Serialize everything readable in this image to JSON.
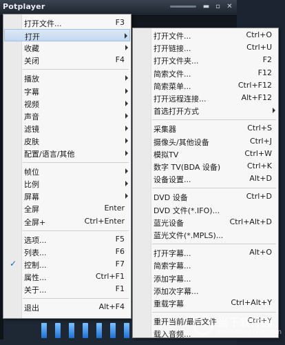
{
  "app": {
    "title": "Potplayer",
    "controls": [
      "▬",
      "▫",
      "✕"
    ]
  },
  "main_menu": [
    {
      "label": "打开文件...",
      "shortcut": "F3"
    },
    {
      "label": "打开",
      "submenu": true,
      "highlighted": true
    },
    {
      "label": "收藏",
      "submenu": true
    },
    {
      "label": "关闭",
      "shortcut": "F4"
    },
    {
      "separator": true
    },
    {
      "label": "播放",
      "submenu": true
    },
    {
      "label": "字幕",
      "submenu": true
    },
    {
      "label": "视频",
      "submenu": true
    },
    {
      "label": "声音",
      "submenu": true
    },
    {
      "label": "滤镜",
      "submenu": true
    },
    {
      "label": "皮肤",
      "submenu": true
    },
    {
      "label": "配置/语言/其他",
      "submenu": true
    },
    {
      "separator": true
    },
    {
      "label": "帧位",
      "submenu": true
    },
    {
      "label": "比例",
      "submenu": true
    },
    {
      "label": "屏幕",
      "submenu": true
    },
    {
      "label": "全屏",
      "shortcut": "Enter"
    },
    {
      "label": "全屏+",
      "shortcut": "Ctrl+Enter"
    },
    {
      "separator": true
    },
    {
      "label": "选项...",
      "shortcut": "F5"
    },
    {
      "label": "列表...",
      "shortcut": "F6"
    },
    {
      "label": "控制...",
      "shortcut": "F7",
      "checked": true
    },
    {
      "label": "属性...",
      "shortcut": "Ctrl+F1"
    },
    {
      "label": "关于...",
      "shortcut": "F1"
    },
    {
      "separator": true
    },
    {
      "label": "退出",
      "shortcut": "Alt+F4"
    }
  ],
  "open_submenu": [
    {
      "label": "打开文件...",
      "shortcut": "Ctrl+O"
    },
    {
      "label": "打开链接...",
      "shortcut": "Ctrl+U"
    },
    {
      "label": "打开文件夹...",
      "shortcut": "F2"
    },
    {
      "label": "简索文件...",
      "shortcut": "F12"
    },
    {
      "label": "简索菜单...",
      "shortcut": "Ctrl+F12"
    },
    {
      "label": "打开远程连接...",
      "shortcut": "Alt+F12"
    },
    {
      "label": "首选打开方式",
      "submenu": true
    },
    {
      "separator": true
    },
    {
      "label": "采集器",
      "shortcut": "Ctrl+S"
    },
    {
      "label": "摄像头/其他设备",
      "shortcut": "Ctrl+J"
    },
    {
      "label": "模拟TV",
      "shortcut": "Ctrl+W"
    },
    {
      "label": "数字 TV(BDA 设备)",
      "shortcut": "Ctrl+K"
    },
    {
      "label": "设备设置...",
      "shortcut": "Alt+D"
    },
    {
      "separator": true
    },
    {
      "label": "DVD 设备",
      "shortcut": "Ctrl+D"
    },
    {
      "label": "DVD 文件(*.IFO)..."
    },
    {
      "label": "蓝光设备",
      "shortcut": "Ctrl+Alt+D"
    },
    {
      "label": "蓝光文件(*.MPLS)..."
    },
    {
      "separator": true
    },
    {
      "label": "打开字幕...",
      "shortcut": "Alt+O"
    },
    {
      "label": "简索字幕..."
    },
    {
      "label": "添加字幕..."
    },
    {
      "label": "添加次字幕..."
    },
    {
      "label": "重载字幕",
      "shortcut": "Ctrl+Alt+Y"
    },
    {
      "separator": true
    },
    {
      "label": "重开当前/最后文件",
      "shortcut": "Ctrl+Y"
    },
    {
      "label": "载入音频..."
    }
  ],
  "watermark": {
    "text": "当下软件园",
    "url": "www.downxia.com"
  },
  "colors": {
    "menu_bg": "#f7f7f7",
    "highlight": "#c3d9f1",
    "check": "#1f5fbf",
    "player_bg": "#1b2430"
  }
}
